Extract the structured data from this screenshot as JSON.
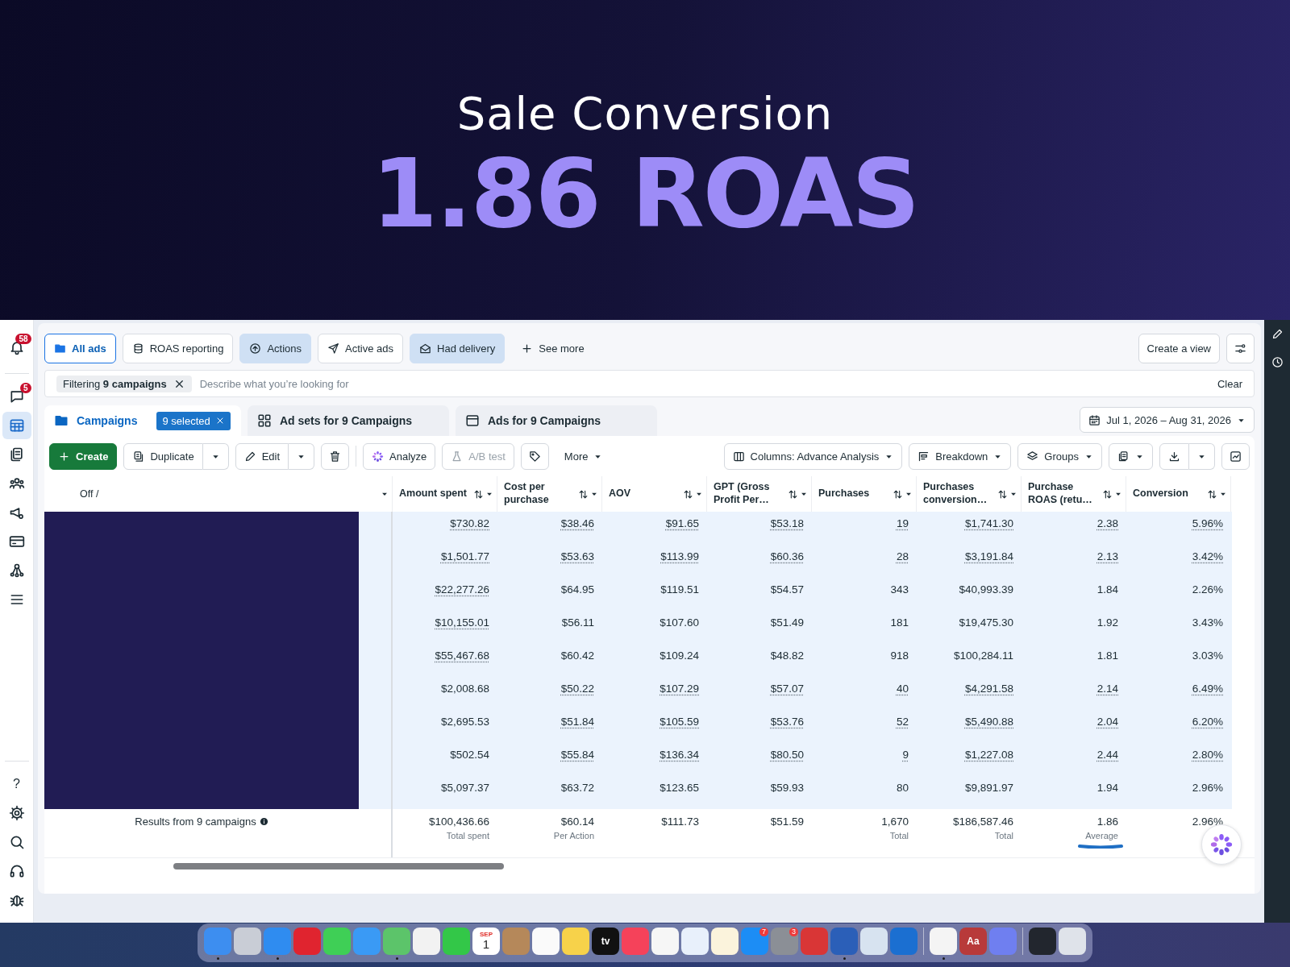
{
  "hero": {
    "title": "Sale Conversion",
    "metric": "1.86 ROAS"
  },
  "sidebar": {
    "items": [
      {
        "kind": "bell",
        "badge": "58",
        "selected": false
      },
      {
        "kind": "chat",
        "badge": "5",
        "selected": false
      },
      {
        "kind": "table",
        "selected": true
      },
      {
        "kind": "pages",
        "selected": false
      },
      {
        "kind": "people",
        "selected": false
      },
      {
        "kind": "megaphone",
        "selected": false
      },
      {
        "kind": "card",
        "selected": false
      },
      {
        "kind": "network",
        "selected": false
      },
      {
        "kind": "menu",
        "selected": false
      }
    ],
    "bottom": [
      {
        "kind": "help",
        "glyph": "?"
      },
      {
        "kind": "gear"
      },
      {
        "kind": "search"
      },
      {
        "kind": "headset"
      },
      {
        "kind": "bug"
      }
    ]
  },
  "view_tabs": [
    {
      "label": "All ads",
      "kind": "folder",
      "selected": true,
      "highlighted": false
    },
    {
      "label": "ROAS reporting",
      "kind": "coins",
      "selected": false,
      "highlighted": false
    },
    {
      "label": "Actions",
      "kind": "upcircle",
      "selected": false,
      "highlighted": true
    },
    {
      "label": "Active ads",
      "kind": "send",
      "selected": false,
      "highlighted": false
    },
    {
      "label": "Had delivery",
      "kind": "envelope",
      "selected": false,
      "highlighted": true
    }
  ],
  "see_more": "See more",
  "create_view": "Create a view",
  "filter": {
    "chip": "Filtering **9 campaigns**",
    "placeholder": "Describe what you’re looking for",
    "clear": "Clear"
  },
  "level_tabs": [
    {
      "label": "Campaigns",
      "kind": "folder",
      "badge": "9 selected",
      "selected": true
    },
    {
      "label": "Ad sets for 9 Campaigns",
      "kind": "grid",
      "selected": false
    },
    {
      "label": "Ads for 9 Campaigns",
      "kind": "window",
      "selected": false
    }
  ],
  "date_range": "Jul 1, 2026 – Aug 31, 2026",
  "toolbar": {
    "create": "Create",
    "duplicate": "Duplicate",
    "edit": "Edit",
    "analyze": "Analyze",
    "ab_test": {
      "label": "A/B test",
      "disabled": true
    },
    "more": "More",
    "columns": "Columns: Advance Analysis",
    "breakdown": "Breakdown",
    "groups": "Groups"
  },
  "table": {
    "first_column": "Off /",
    "columns": [
      "Amount spent",
      "Cost per purchase",
      "AOV",
      "GPT (Gross Profit Per…",
      "Purchases",
      "Purchases conversion…",
      "Purchase ROAS (retu…",
      "Conversion"
    ],
    "rows": [
      {
        "selected": true,
        "cells": [
          {
            "text": "$730.82",
            "linked": true
          },
          {
            "text": "$38.46",
            "linked": true
          },
          {
            "text": "$91.65",
            "linked": true
          },
          {
            "text": "$53.18",
            "linked": true
          },
          {
            "text": "19",
            "linked": true
          },
          {
            "text": "$1,741.30",
            "linked": true
          },
          {
            "text": "2.38",
            "linked": true
          },
          {
            "text": "5.96%",
            "linked": true
          }
        ]
      },
      {
        "selected": true,
        "cells": [
          {
            "text": "$1,501.77",
            "linked": true
          },
          {
            "text": "$53.63",
            "linked": true
          },
          {
            "text": "$113.99",
            "linked": true
          },
          {
            "text": "$60.36",
            "linked": true
          },
          {
            "text": "28",
            "linked": true
          },
          {
            "text": "$3,191.84",
            "linked": true
          },
          {
            "text": "2.13",
            "linked": true
          },
          {
            "text": "3.42%",
            "linked": true
          }
        ]
      },
      {
        "selected": true,
        "cells": [
          {
            "text": "$22,277.26",
            "linked": true
          },
          {
            "text": "$64.95",
            "linked": false
          },
          {
            "text": "$119.51",
            "linked": false
          },
          {
            "text": "$54.57",
            "linked": false
          },
          {
            "text": "343",
            "linked": false
          },
          {
            "text": "$40,993.39",
            "linked": false
          },
          {
            "text": "1.84",
            "linked": false
          },
          {
            "text": "2.26%",
            "linked": false
          }
        ]
      },
      {
        "selected": true,
        "cells": [
          {
            "text": "$10,155.01",
            "linked": true
          },
          {
            "text": "$56.11",
            "linked": false
          },
          {
            "text": "$107.60",
            "linked": false
          },
          {
            "text": "$51.49",
            "linked": false
          },
          {
            "text": "181",
            "linked": false
          },
          {
            "text": "$19,475.30",
            "linked": false
          },
          {
            "text": "1.92",
            "linked": false
          },
          {
            "text": "3.43%",
            "linked": false
          }
        ]
      },
      {
        "selected": true,
        "cells": [
          {
            "text": "$55,467.68",
            "linked": true
          },
          {
            "text": "$60.42",
            "linked": false
          },
          {
            "text": "$109.24",
            "linked": false
          },
          {
            "text": "$48.82",
            "linked": false
          },
          {
            "text": "918",
            "linked": false
          },
          {
            "text": "$100,284.11",
            "linked": false
          },
          {
            "text": "1.81",
            "linked": false
          },
          {
            "text": "3.03%",
            "linked": false
          }
        ]
      },
      {
        "selected": true,
        "cells": [
          {
            "text": "$2,008.68",
            "linked": false
          },
          {
            "text": "$50.22",
            "linked": true
          },
          {
            "text": "$107.29",
            "linked": true
          },
          {
            "text": "$57.07",
            "linked": true
          },
          {
            "text": "40",
            "linked": true
          },
          {
            "text": "$4,291.58",
            "linked": true
          },
          {
            "text": "2.14",
            "linked": true
          },
          {
            "text": "6.49%",
            "linked": true
          }
        ]
      },
      {
        "selected": true,
        "cells": [
          {
            "text": "$2,695.53",
            "linked": false
          },
          {
            "text": "$51.84",
            "linked": true
          },
          {
            "text": "$105.59",
            "linked": true
          },
          {
            "text": "$53.76",
            "linked": true
          },
          {
            "text": "52",
            "linked": true
          },
          {
            "text": "$5,490.88",
            "linked": true
          },
          {
            "text": "2.04",
            "linked": true
          },
          {
            "text": "6.20%",
            "linked": true
          }
        ]
      },
      {
        "selected": true,
        "cells": [
          {
            "text": "$502.54",
            "linked": false
          },
          {
            "text": "$55.84",
            "linked": true
          },
          {
            "text": "$136.34",
            "linked": true
          },
          {
            "text": "$80.50",
            "linked": true
          },
          {
            "text": "9",
            "linked": true
          },
          {
            "text": "$1,227.08",
            "linked": true
          },
          {
            "text": "2.44",
            "linked": true
          },
          {
            "text": "2.80%",
            "linked": true
          }
        ]
      },
      {
        "selected": true,
        "cells": [
          {
            "text": "$5,097.37",
            "linked": false
          },
          {
            "text": "$63.72",
            "linked": false
          },
          {
            "text": "$123.65",
            "linked": false
          },
          {
            "text": "$59.93",
            "linked": false
          },
          {
            "text": "80",
            "linked": false
          },
          {
            "text": "$9,891.97",
            "linked": false
          },
          {
            "text": "1.94",
            "linked": false
          },
          {
            "text": "2.96%",
            "linked": false
          }
        ]
      }
    ],
    "totals": {
      "label": "Results from 9 campaigns",
      "cells": [
        {
          "value": "$100,436.66",
          "note": "Total spent"
        },
        {
          "value": "$60.14",
          "note": "Per Action"
        },
        {
          "value": "$111.73"
        },
        {
          "value": "$51.59"
        },
        {
          "value": "1,670",
          "note": "Total"
        },
        {
          "value": "$186,587.46",
          "note": "Total"
        },
        {
          "value": "1.86",
          "note": "Average",
          "marked": true
        },
        {
          "value": "2.96%"
        }
      ]
    }
  },
  "dock": [
    {
      "color": "#3d8ef0",
      "running": true
    },
    {
      "color": "#c9cdd6",
      "running": false
    },
    {
      "color": "#2f8cf0",
      "running": true
    },
    {
      "color": "#e0242f",
      "running": false
    },
    {
      "color": "#3fcf56",
      "running": false
    },
    {
      "color": "#3a9af5",
      "running": false
    },
    {
      "color": "#5cc46a",
      "running": true
    },
    {
      "color": "#f2f2f2",
      "running": false
    },
    {
      "color": "#33c748",
      "running": false
    },
    {
      "color": "#ffffff",
      "running": false,
      "top": "SEP",
      "text": "1"
    },
    {
      "color": "#b5885a",
      "running": false
    },
    {
      "color": "#fafafa",
      "running": false
    },
    {
      "color": "#f7d24a",
      "running": false
    },
    {
      "color": "#111111",
      "running": false,
      "text": "tv"
    },
    {
      "color": "#f5425a",
      "running": false
    },
    {
      "color": "#f6f6f6",
      "running": false
    },
    {
      "color": "#e8f0fb",
      "running": false
    },
    {
      "color": "#fbf3dc",
      "running": false
    },
    {
      "color": "#1c8df5",
      "running": false,
      "badge": "7"
    },
    {
      "color": "#8b8f96",
      "running": false,
      "badge": "3"
    },
    {
      "color": "#d93636",
      "running": false
    },
    {
      "color": "#2b5fb8",
      "running": true
    },
    {
      "color": "#d7e3f0",
      "running": false
    },
    {
      "color": "#1b6fd1",
      "running": false
    },
    {
      "sep": true
    },
    {
      "color": "#f4f4f4",
      "running": true
    },
    {
      "color": "#b83a3a",
      "running": false,
      "text": "Aa"
    },
    {
      "color": "#6f7ff0",
      "running": false
    },
    {
      "sep": true
    },
    {
      "color": "#22262e",
      "running": false
    },
    {
      "color": "#dfe3ea",
      "running": false
    }
  ]
}
